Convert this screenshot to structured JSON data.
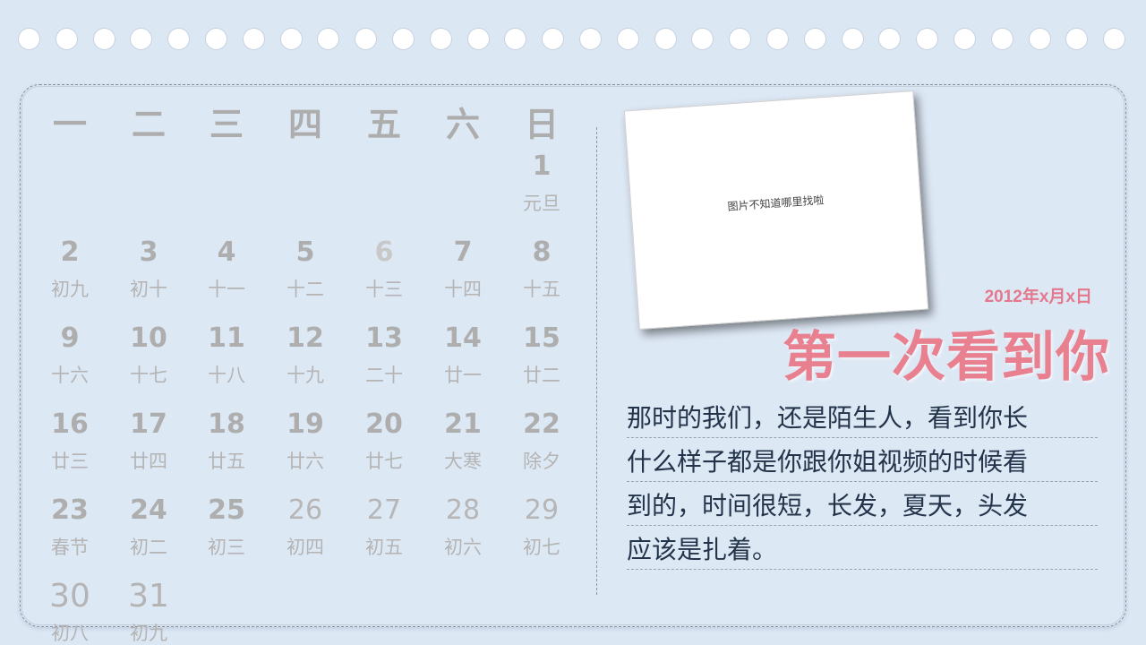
{
  "calendar": {
    "weekdays": [
      "一",
      "二",
      "三",
      "四",
      "五",
      "六",
      "日"
    ],
    "days": [
      {
        "n": "1",
        "l": "元旦"
      },
      {
        "n": "2",
        "l": "初九"
      },
      {
        "n": "3",
        "l": "初十"
      },
      {
        "n": "4",
        "l": "十一"
      },
      {
        "n": "5",
        "l": "十二"
      },
      {
        "n": "6",
        "l": "十三"
      },
      {
        "n": "7",
        "l": "十四"
      },
      {
        "n": "8",
        "l": "十五"
      },
      {
        "n": "9",
        "l": "十六"
      },
      {
        "n": "10",
        "l": "十七"
      },
      {
        "n": "11",
        "l": "十八"
      },
      {
        "n": "12",
        "l": "十九"
      },
      {
        "n": "13",
        "l": "二十"
      },
      {
        "n": "14",
        "l": "廿一"
      },
      {
        "n": "15",
        "l": "廿二"
      },
      {
        "n": "16",
        "l": "廿三"
      },
      {
        "n": "17",
        "l": "廿四"
      },
      {
        "n": "18",
        "l": "廿五"
      },
      {
        "n": "19",
        "l": "廿六"
      },
      {
        "n": "20",
        "l": "廿七"
      },
      {
        "n": "21",
        "l": "大寒"
      },
      {
        "n": "22",
        "l": "除夕"
      },
      {
        "n": "23",
        "l": "春节"
      },
      {
        "n": "24",
        "l": "初二"
      },
      {
        "n": "25",
        "l": "初三"
      },
      {
        "n": "26",
        "l": "初四"
      },
      {
        "n": "27",
        "l": "初五"
      },
      {
        "n": "28",
        "l": "初六"
      },
      {
        "n": "29",
        "l": "初七"
      },
      {
        "n": "30",
        "l": "初八"
      },
      {
        "n": "31",
        "l": "初九"
      }
    ]
  },
  "photo": {
    "placeholder_text": "图片不知道哪里找啦"
  },
  "entry": {
    "date": "2012年x月x日",
    "title": "第一次看到你",
    "lines": [
      "那时的我们，还是陌生人，看到你长",
      "什么样子都是你跟你姐视频的时候看",
      "到的，时间很短，长发，夏天，头发",
      "应该是扎着。"
    ]
  },
  "colors": {
    "accent": "#e8808f",
    "text": "#23334a",
    "background": "#dce7f4"
  }
}
